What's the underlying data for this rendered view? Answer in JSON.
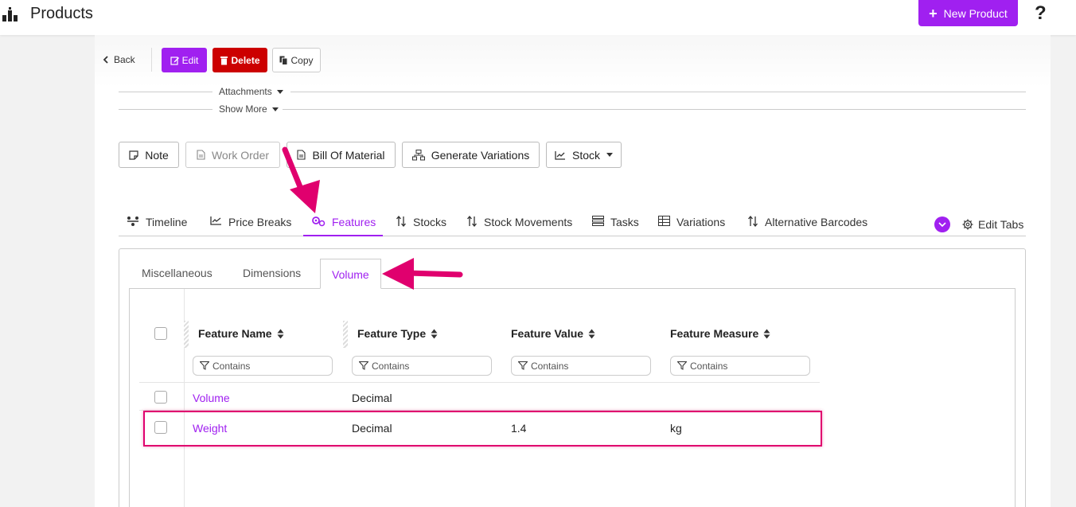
{
  "header": {
    "title": "Products",
    "new_product_label": "New Product",
    "help_label": "?",
    "accent_color": "#a020f0"
  },
  "toolbar": {
    "back_label": "Back",
    "edit_label": "Edit",
    "delete_label": "Delete",
    "copy_label": "Copy"
  },
  "sections": {
    "attachments_label": "Attachments",
    "show_more_label": "Show More"
  },
  "actions": {
    "note_label": "Note",
    "work_order_label": "Work Order",
    "bill_of_material_label": "Bill Of Material",
    "generate_variations_label": "Generate Variations",
    "stock_label": "Stock"
  },
  "tabs": {
    "items": [
      {
        "label": "Timeline",
        "icon": "timeline-icon"
      },
      {
        "label": "Price Breaks",
        "icon": "chart-line-icon"
      },
      {
        "label": "Features",
        "icon": "gears-icon",
        "active": true
      },
      {
        "label": "Stocks",
        "icon": "sort-icon"
      },
      {
        "label": "Stock Movements",
        "icon": "sort-icon"
      },
      {
        "label": "Tasks",
        "icon": "list-icon"
      },
      {
        "label": "Variations",
        "icon": "table-icon"
      },
      {
        "label": "Alternative Barcodes",
        "icon": "sort-icon"
      }
    ],
    "edit_tabs_label": "Edit Tabs"
  },
  "feature_subtabs": {
    "items": [
      "Miscellaneous",
      "Dimensions",
      "Volume"
    ],
    "active": "Volume"
  },
  "grid": {
    "columns": [
      "Feature Name",
      "Feature Type",
      "Feature Value",
      "Feature Measure"
    ],
    "filter_placeholder": "Contains",
    "rows": [
      {
        "name": "Volume",
        "type": "Decimal",
        "value": "",
        "measure": ""
      },
      {
        "name": "Weight",
        "type": "Decimal",
        "value": "1.4",
        "measure": "kg"
      }
    ]
  },
  "annotation_color": "#e0006e"
}
